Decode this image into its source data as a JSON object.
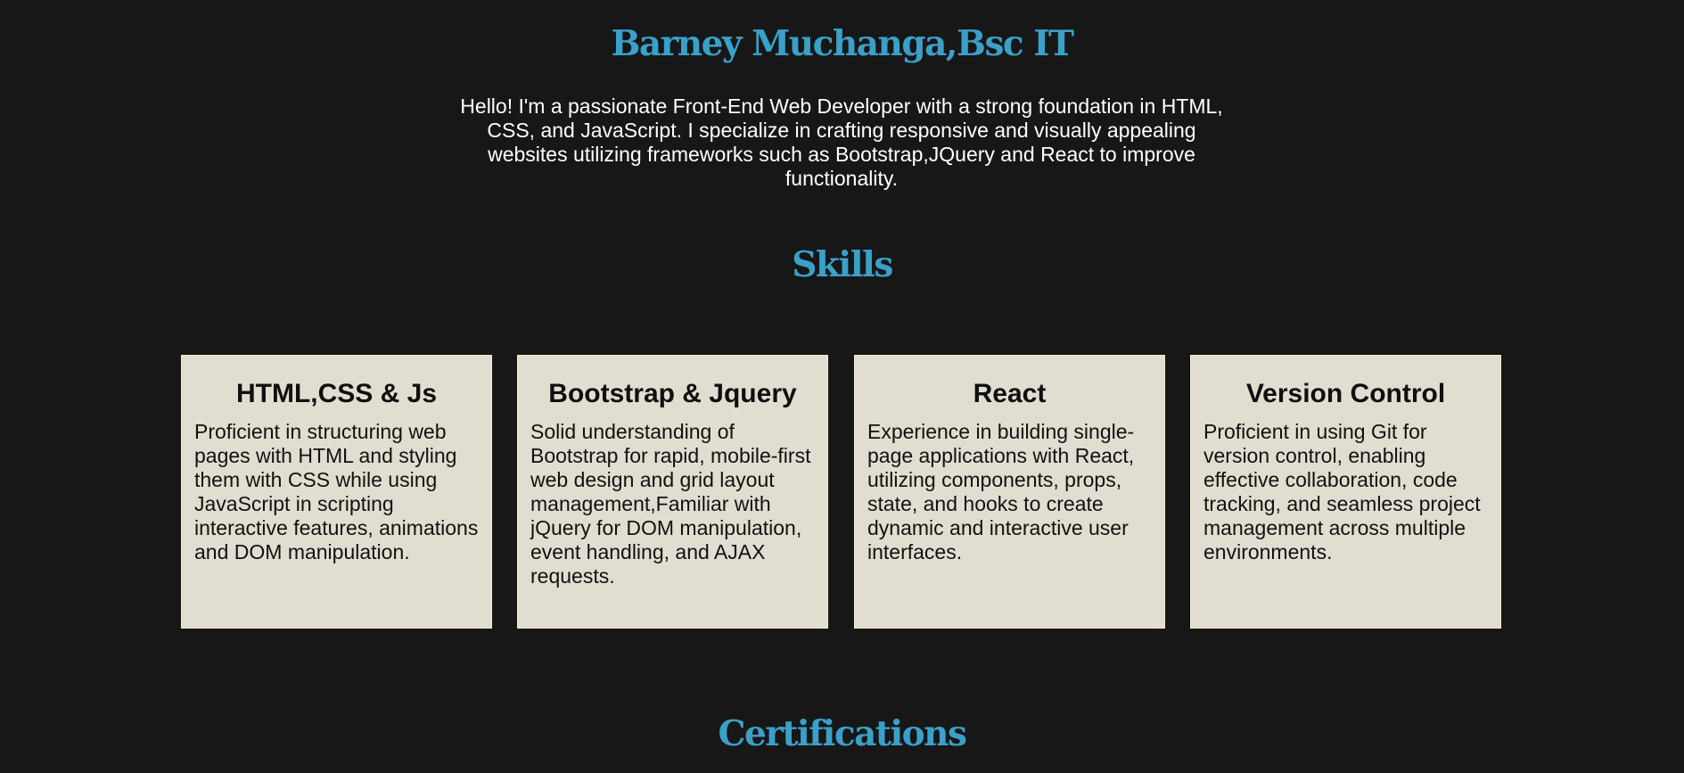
{
  "header": {
    "name": "Barney Muchanga,Bsc IT",
    "intro": "Hello! I'm a passionate Front-End Web Developer with a strong foundation in HTML, CSS, and JavaScript. I specialize in crafting responsive and visually appealing websites utilizing frameworks such as Bootstrap,JQuery and React to improve functionality."
  },
  "skills": {
    "title": "Skills",
    "cards": [
      {
        "title": "HTML,CSS & Js",
        "text": "Proficient in structuring web pages with HTML and styling them with CSS while using JavaScript in scripting interactive features, animations and DOM manipulation."
      },
      {
        "title": "Bootstrap & Jquery",
        "text": "Solid understanding of Bootstrap for rapid, mobile-first web design and grid layout management,Familiar with jQuery for DOM manipulation, event handling, and AJAX requests."
      },
      {
        "title": "React",
        "text": "Experience in building single-page applications with React, utilizing components, props, state, and hooks to create dynamic and interactive user interfaces."
      },
      {
        "title": "Version Control",
        "text": "Proficient in using Git for version control, enabling effective collaboration, code tracking, and seamless project management across multiple environments."
      }
    ]
  },
  "certifications": {
    "title": "Certifications"
  },
  "colors": {
    "background": "#171717",
    "heading": "#3aa0c9",
    "card_background": "#e1ddd0",
    "card_border": "#f3ecc3",
    "intro_text": "#ffffff"
  }
}
